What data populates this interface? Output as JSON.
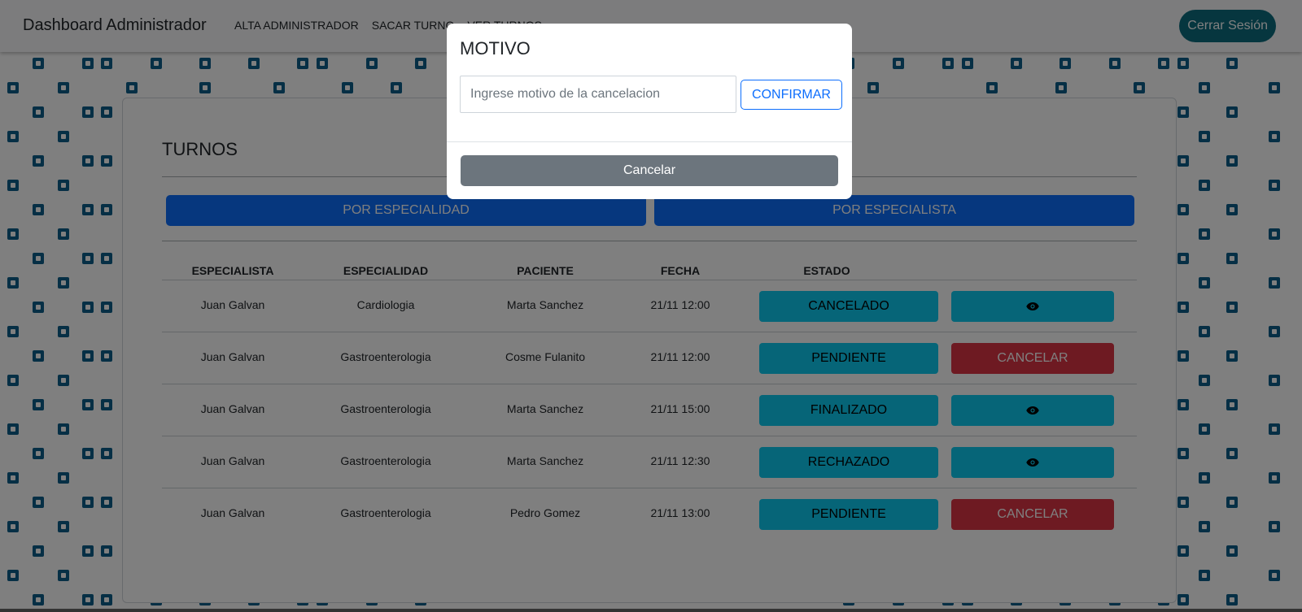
{
  "navbar": {
    "brand": "Dashboard Administrador",
    "links": [
      "ALTA ADMINISTRADOR",
      "SACAR TURNO",
      "VER TURNOS"
    ],
    "logout_label": "Cerrar Sesión"
  },
  "main": {
    "title": "TURNOS",
    "filters": [
      "POR ESPECIALIDAD",
      "POR ESPECIALISTA"
    ],
    "table": {
      "headers": [
        "ESPECIALISTA",
        "ESPECIALIDAD",
        "PACIENTE",
        "FECHA",
        "ESTADO"
      ],
      "rows": [
        {
          "especialista": "Juan Galvan",
          "especialidad": "Cardiologia",
          "paciente": "Marta Sanchez",
          "fecha": "21/11 12:00",
          "estado": "CANCELADO",
          "action": "view"
        },
        {
          "especialista": "Juan Galvan",
          "especialidad": "Gastroenterologia",
          "paciente": "Cosme Fulanito",
          "fecha": "21/11 12:00",
          "estado": "PENDIENTE",
          "action": "CANCELAR"
        },
        {
          "especialista": "Juan Galvan",
          "especialidad": "Gastroenterologia",
          "paciente": "Marta Sanchez",
          "fecha": "21/11 15:00",
          "estado": "FINALIZADO",
          "action": "view"
        },
        {
          "especialista": "Juan Galvan",
          "especialidad": "Gastroenterologia",
          "paciente": "Marta Sanchez",
          "fecha": "21/11 12:30",
          "estado": "RECHAZADO",
          "action": "view"
        },
        {
          "especialista": "Juan Galvan",
          "especialidad": "Gastroenterologia",
          "paciente": "Pedro Gomez",
          "fecha": "21/11 13:00",
          "estado": "PENDIENTE",
          "action": "CANCELAR"
        }
      ]
    }
  },
  "modal": {
    "title": "MOTIVO",
    "input_placeholder": "Ingrese motivo de la cancelacion",
    "input_value": "",
    "confirm_label": "CONFIRMAR",
    "cancel_label": "Cancelar"
  },
  "colors": {
    "primary": "#0d6efd",
    "info": "#0dcaf0",
    "danger": "#dc3545",
    "secondary": "#6c757d",
    "logout": "#0d6c7e",
    "pattern": "#0d5f8a"
  },
  "icons": {
    "view_action": "eye-icon",
    "background_tile": "medical-cross-icon"
  }
}
